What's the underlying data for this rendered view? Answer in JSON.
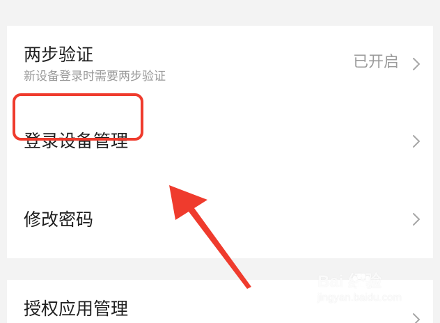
{
  "screen": {
    "background": "#f3f3f3",
    "card_background": "#ffffff",
    "divider_color": "#e7e7e7",
    "annotation_color": "#ef3b2d"
  },
  "settings": {
    "items": [
      {
        "label": "两步验证",
        "description": "新设备登录时需要两步验证",
        "status": "已开启",
        "icon": "chevron-right-icon"
      },
      {
        "label": "登录设备管理",
        "icon": "chevron-right-icon"
      },
      {
        "label": "修改密码",
        "icon": "chevron-right-icon"
      },
      {
        "label": "授权应用管理",
        "icon": "chevron-right-icon"
      }
    ]
  },
  "annotation": {
    "highlight_target": "登录设备管理",
    "arrow_icon": "red-arrow-icon"
  },
  "watermark": {
    "logo_text": "Bai 经验",
    "url": "jingyan.baidu.com",
    "icon": "baidu-paw-icon"
  }
}
